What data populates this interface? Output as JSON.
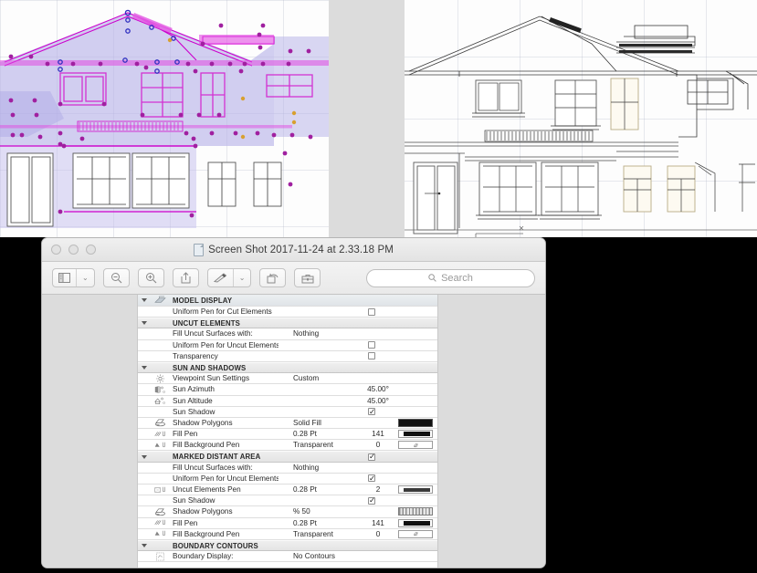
{
  "window": {
    "title": "Screen Shot 2017-11-24 at 2.33.18 PM",
    "doc_icon": "document-icon",
    "traffic_lights": [
      "close-button",
      "minimize-button",
      "zoom-button"
    ]
  },
  "toolbar": {
    "sidebar_label": "▤",
    "sidebar_chevron": "⌄",
    "zoom_out": "⊖",
    "zoom_in": "⊕",
    "share": "⇧",
    "markup": "✎",
    "markup_chevron": "⌄",
    "rotate": "↻",
    "toolbox": "⚒",
    "search_placeholder": "Search",
    "search_icon": "search-icon"
  },
  "inspector": {
    "title": "MODEL DISPLAY",
    "rows": [
      {
        "kind": "title",
        "label": "MODEL DISPLAY",
        "icon": "model-display-icon",
        "triangle": true
      },
      {
        "kind": "item",
        "label": "Uniform Pen for Cut Elements",
        "checkbox": false
      },
      {
        "kind": "header",
        "label": "UNCUT ELEMENTS",
        "triangle": true
      },
      {
        "kind": "item",
        "label": "Fill Uncut Surfaces with:",
        "value": "Nothing"
      },
      {
        "kind": "item",
        "label": "Uniform Pen for Uncut Elements",
        "checkbox": false
      },
      {
        "kind": "item",
        "label": "Transparency",
        "checkbox": false
      },
      {
        "kind": "header",
        "label": "SUN AND SHADOWS",
        "triangle": true
      },
      {
        "kind": "item",
        "label": "Viewpoint Sun Settings",
        "value": "Custom",
        "icon": "sun-icon"
      },
      {
        "kind": "item",
        "label": "Sun Azimuth",
        "value": "",
        "number": "45.00°",
        "icon": "sun-azimuth-icon"
      },
      {
        "kind": "item",
        "label": "Sun Altitude",
        "value": "",
        "number": "45.00°",
        "icon": "sun-altitude-icon"
      },
      {
        "kind": "item",
        "label": "Sun Shadow",
        "checkbox": true
      },
      {
        "kind": "item",
        "label": "Shadow Polygons",
        "value": "Solid Fill",
        "icon": "shadow-polygon-icon",
        "swatch": "solid"
      },
      {
        "kind": "item",
        "label": "Fill Pen",
        "value": "0.28 Pt",
        "number": "141",
        "icon": "fill-pen-icon",
        "swatch": "pen"
      },
      {
        "kind": "item",
        "label": "Fill Background Pen",
        "value": "Transparent",
        "number": "0",
        "icon": "fill-bg-pen-icon",
        "swatch": "transparent"
      },
      {
        "kind": "header",
        "label": "MARKED DISTANT AREA",
        "triangle": true,
        "checkbox": true
      },
      {
        "kind": "item",
        "label": "Fill Uncut Surfaces with:",
        "value": "Nothing"
      },
      {
        "kind": "item",
        "label": "Uniform Pen for Uncut Elements",
        "checkbox": true
      },
      {
        "kind": "item",
        "label": "Uncut Elements Pen",
        "value": "0.28 Pt",
        "number": "2",
        "icon": "uncut-elements-pen-icon",
        "swatch": "pen-thin"
      },
      {
        "kind": "item",
        "label": "Sun Shadow",
        "checkbox": true
      },
      {
        "kind": "item",
        "label": "Shadow Polygons",
        "value": "%  50",
        "icon": "shadow-polygon-icon",
        "swatch": "hatch"
      },
      {
        "kind": "item",
        "label": "Fill Pen",
        "value": "0.28 Pt",
        "number": "141",
        "icon": "fill-pen-icon",
        "swatch": "pen"
      },
      {
        "kind": "item",
        "label": "Fill Background Pen",
        "value": "Transparent",
        "number": "0",
        "icon": "fill-bg-pen-icon",
        "swatch": "transparent"
      },
      {
        "kind": "header",
        "label": "BOUNDARY CONTOURS",
        "triangle": true
      },
      {
        "kind": "item",
        "label": "Boundary Display:",
        "value": "No Contours",
        "icon": "boundary-display-icon"
      }
    ]
  },
  "colors": {
    "selection_magenta": "#cc33cc",
    "selection_fill": "#b9b4ea",
    "window_chrome": "#f0f0f0",
    "rail_gray": "#dcdcdc",
    "swatch_black": "#111111"
  },
  "elevations": {
    "left_caption": "selected-elevation-magenta",
    "right_caption": "elevation-linework"
  }
}
